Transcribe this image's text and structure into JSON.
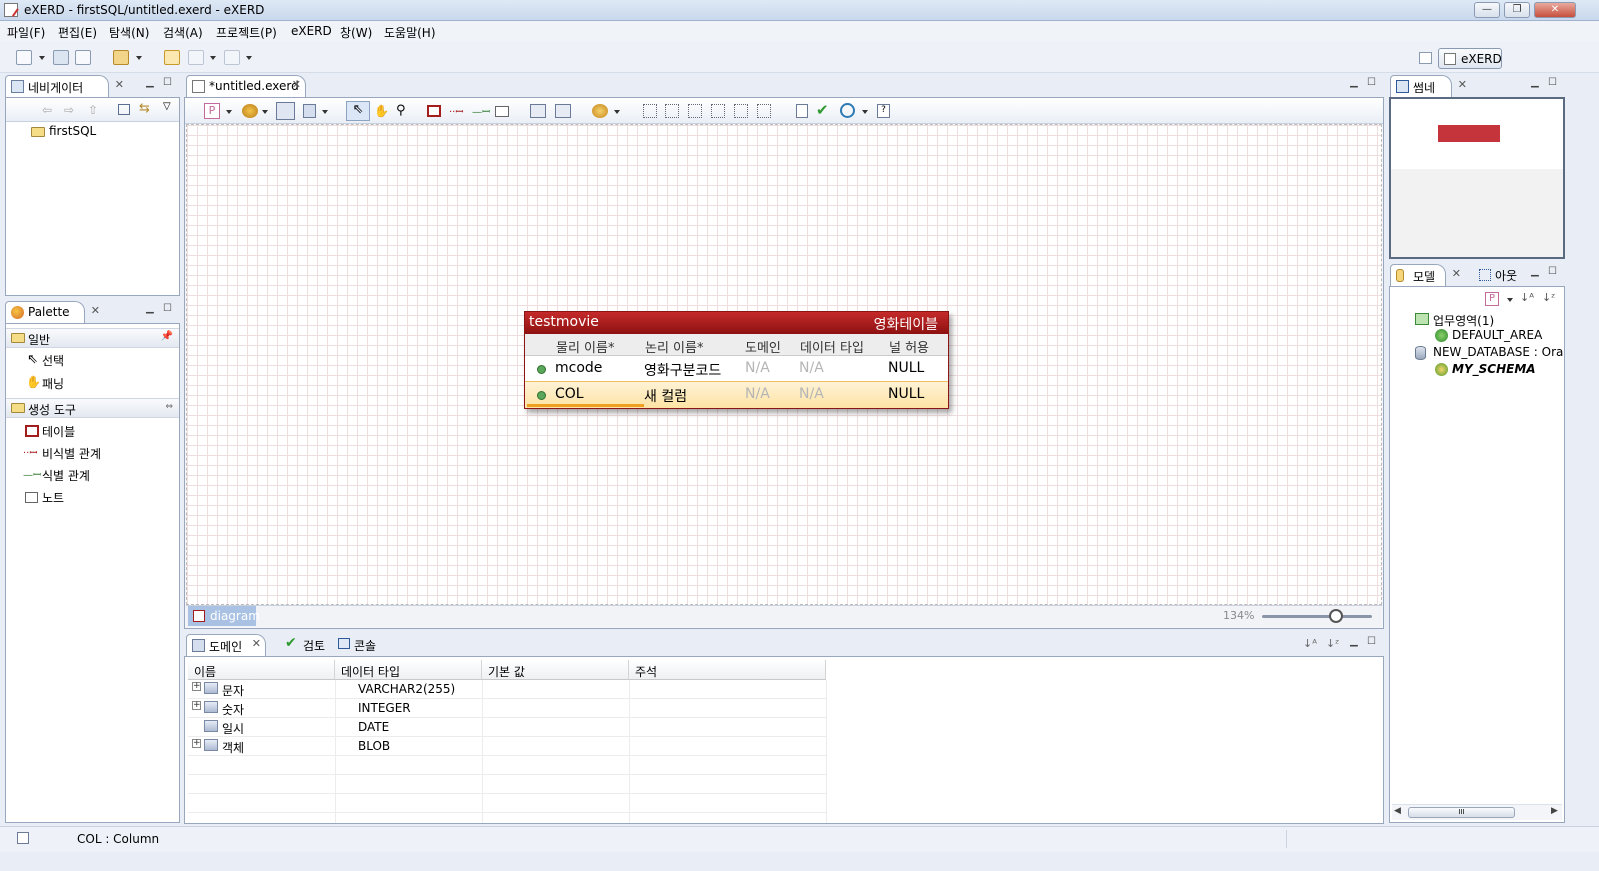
{
  "window": {
    "title": "eXERD - firstSQL/untitled.exerd - eXERD",
    "min": "—",
    "max": "❐",
    "close": "✕"
  },
  "menu": [
    "파일(F)",
    "편집(E)",
    "탐색(N)",
    "검색(A)",
    "프로젝트(P)",
    "eXERD",
    "창(W)",
    "도움말(H)"
  ],
  "perspective": {
    "label": "eXERD"
  },
  "navigator": {
    "tab": "네비게이터",
    "items": [
      "firstSQL"
    ]
  },
  "palette": {
    "tab": "Palette",
    "sections": [
      {
        "label": "일반",
        "items": [
          "선택",
          "패닝"
        ]
      },
      {
        "label": "생성 도구",
        "items": [
          "테이블",
          "비식별 관계",
          "식별 관계",
          "노트"
        ]
      }
    ]
  },
  "editor": {
    "tab": "*untitled.exerd",
    "diagram_tab": "diagram",
    "zoom": "134%",
    "zoom_fraction": 0.67
  },
  "entity": {
    "name": "testmovie",
    "logical": "영화테이블",
    "headers": [
      "물리 이름*",
      "논리 이름*",
      "도메인",
      "데이터 타입",
      "널 허용"
    ],
    "rows": [
      {
        "physical": "mcode",
        "logical": "영화구분코드",
        "domain": "N/A",
        "type": "N/A",
        "null": "NULL",
        "selected": false
      },
      {
        "physical": "COL",
        "logical": "새 컬럼",
        "domain": "N/A",
        "type": "N/A",
        "null": "NULL",
        "selected": true
      }
    ]
  },
  "bottom": {
    "tabs": [
      "도메인",
      "검토",
      "콘솔"
    ],
    "columns": [
      "이름",
      "데이터 타입",
      "기본 값",
      "주석"
    ],
    "rows": [
      {
        "name": "문자",
        "type": "VARCHAR2(255)",
        "expandable": true
      },
      {
        "name": "숫자",
        "type": "INTEGER",
        "expandable": true
      },
      {
        "name": "일시",
        "type": "DATE",
        "expandable": false
      },
      {
        "name": "객체",
        "type": "BLOB",
        "expandable": true
      }
    ]
  },
  "thumbnail": {
    "tab": "썸네일"
  },
  "model": {
    "tab": "모델",
    "tab2": "아웃",
    "tree": [
      {
        "label": "업무영역(1)"
      },
      {
        "label": "DEFAULT_AREA"
      },
      {
        "label": "NEW_DATABASE : Orac"
      },
      {
        "label": "MY_SCHEMA"
      }
    ]
  },
  "status": {
    "text": "COL : Column"
  },
  "colors": {
    "entity_header": "#a51c1c",
    "selected_row": "#fde9b8",
    "grid": "#f0dede"
  }
}
